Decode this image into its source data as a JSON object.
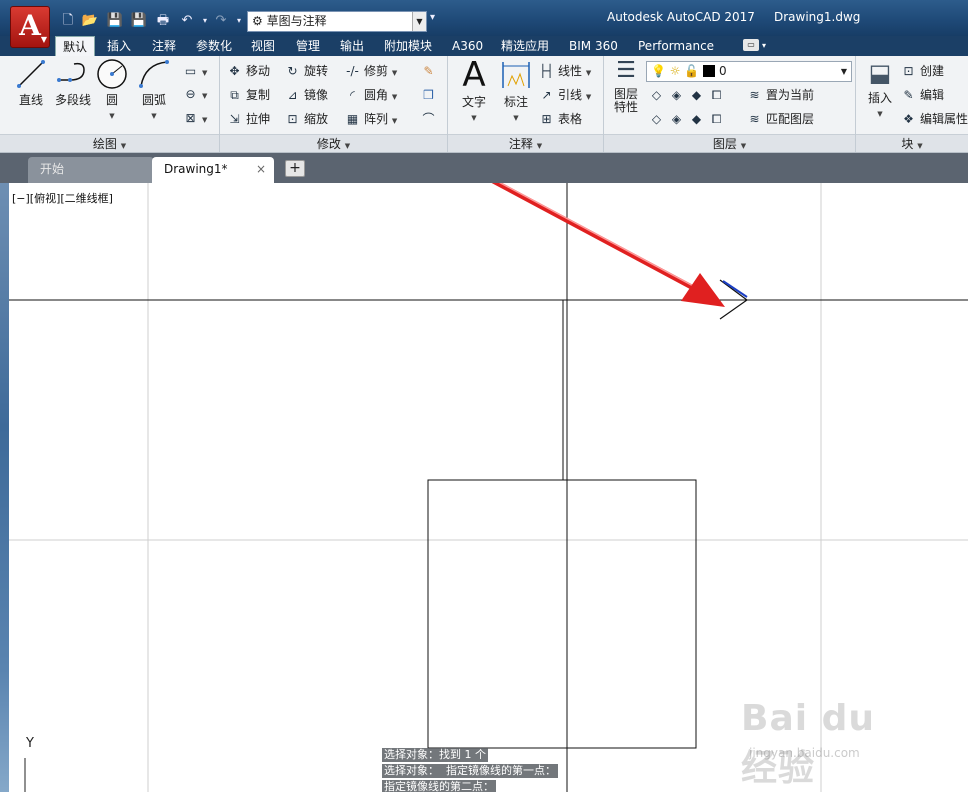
{
  "titlebar": {
    "app_letter": "A",
    "workspace": "草图与注释",
    "app_title": "Autodesk AutoCAD 2017",
    "document_title": "Drawing1.dwg"
  },
  "ribbon_tabs": [
    "默认",
    "插入",
    "注释",
    "参数化",
    "视图",
    "管理",
    "输出",
    "附加模块",
    "A360",
    "精选应用",
    "BIM 360",
    "Performance"
  ],
  "active_tab": "默认",
  "panels": {
    "draw": {
      "title": "绘图",
      "line": "直线",
      "polyline": "多段线",
      "circle": "圆",
      "arc": "圆弧"
    },
    "modify": {
      "title": "修改",
      "move": "移动",
      "rotate": "旋转",
      "trim": "修剪",
      "copy": "复制",
      "mirror": "镜像",
      "fillet": "圆角",
      "stretch": "拉伸",
      "scale": "缩放",
      "array": "阵列"
    },
    "annotation": {
      "title": "注释",
      "text": "文字",
      "dimension": "标注",
      "linear": "线性",
      "leader": "引线",
      "table": "表格"
    },
    "layers": {
      "title": "图层",
      "properties_line1": "图层",
      "properties_line2": "特性",
      "current_layer": "0",
      "set_current": "置为当前",
      "match_layer": "匹配图层"
    },
    "block": {
      "title": "块",
      "insert": "插入",
      "create": "创建",
      "edit": "编辑",
      "edit_attributes": "编辑属性"
    }
  },
  "doc_tabs": {
    "start": "开始",
    "drawing": "Drawing1*",
    "close": "×",
    "add": "+"
  },
  "viewport_label": "[−][俯视][二维线框]",
  "command_history": [
    "选择对象：找到 1 个",
    "选择对象：  指定镜像线的第一点：",
    "指定镜像线的第二点："
  ],
  "ucs_axis": "Y",
  "watermark": {
    "text": "Bai du 经验",
    "url": "jingyan.baidu.com"
  },
  "colors": {
    "titlebar": "#1f4a78",
    "app_button": "#c0231b",
    "annotation_arrow": "#e02020",
    "cursor_tick": "#1c3fc4"
  }
}
